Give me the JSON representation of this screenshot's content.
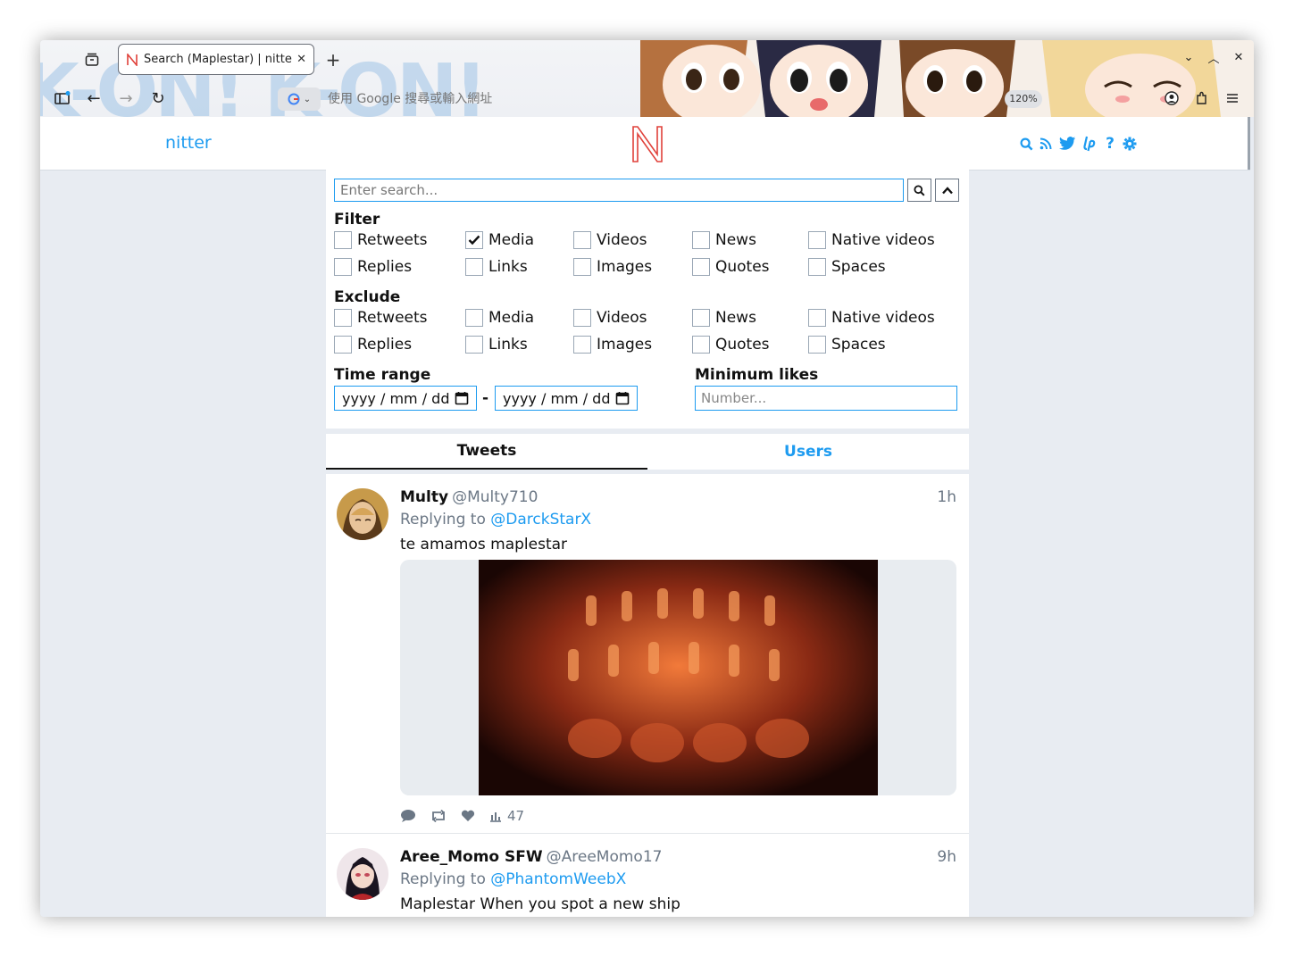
{
  "browser": {
    "tab_title": "Search (Maplestar) | nitter",
    "url_placeholder": "使用 Google 搜尋或輸入網址",
    "zoom": "120%",
    "engine": "G"
  },
  "nav": {
    "brand": "nitter",
    "icons": [
      "search-icon",
      "rss-icon",
      "twitter-icon",
      "liberapay-icon",
      "help-icon",
      "settings-icon"
    ]
  },
  "search": {
    "placeholder": "Enter search...",
    "filter_title": "Filter",
    "exclude_title": "Exclude",
    "filter_options": [
      {
        "label": "Retweets",
        "checked": false
      },
      {
        "label": "Media",
        "checked": true
      },
      {
        "label": "Videos",
        "checked": false
      },
      {
        "label": "News",
        "checked": false
      },
      {
        "label": "Native videos",
        "checked": false
      },
      {
        "label": "Replies",
        "checked": false
      },
      {
        "label": "Links",
        "checked": false
      },
      {
        "label": "Images",
        "checked": false
      },
      {
        "label": "Quotes",
        "checked": false
      },
      {
        "label": "Spaces",
        "checked": false
      }
    ],
    "exclude_options": [
      {
        "label": "Retweets",
        "checked": false
      },
      {
        "label": "Media",
        "checked": false
      },
      {
        "label": "Videos",
        "checked": false
      },
      {
        "label": "News",
        "checked": false
      },
      {
        "label": "Native videos",
        "checked": false
      },
      {
        "label": "Replies",
        "checked": false
      },
      {
        "label": "Links",
        "checked": false
      },
      {
        "label": "Images",
        "checked": false
      },
      {
        "label": "Quotes",
        "checked": false
      },
      {
        "label": "Spaces",
        "checked": false
      }
    ],
    "time_range_title": "Time range",
    "date_placeholder": "yyyy / mm / dd",
    "date_separator": "-",
    "min_likes_title": "Minimum likes",
    "min_likes_placeholder": "Number..."
  },
  "tabs": {
    "tweets": "Tweets",
    "users": "Users"
  },
  "tweets": [
    {
      "name": "Multy",
      "handle": "@Multy710",
      "time": "1h",
      "replying_label": "Replying to",
      "replying_to": "@DarckStarX",
      "text": "te amamos maplestar",
      "views": "47"
    },
    {
      "name": "Aree_Momo SFW",
      "handle": "@AreeMomo17",
      "time": "9h",
      "replying_label": "Replying to",
      "replying_to": "@PhantomWeebX",
      "text": "Maplestar When you spot a new ship"
    }
  ],
  "colors": {
    "accent": "#1d9bf0",
    "bg": "#e8ecf2",
    "logo": "#e0413a"
  }
}
